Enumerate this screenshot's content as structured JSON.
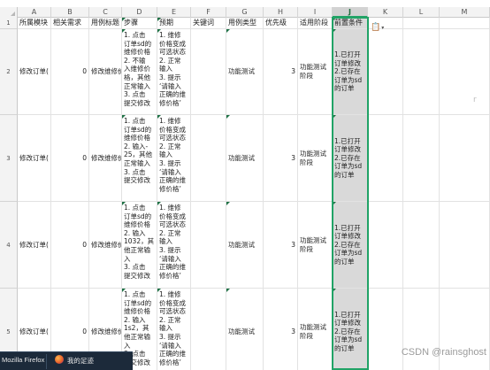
{
  "columns": [
    {
      "letter": "A"
    },
    {
      "letter": "B"
    },
    {
      "letter": "C"
    },
    {
      "letter": "D"
    },
    {
      "letter": "E"
    },
    {
      "letter": "F"
    },
    {
      "letter": "G"
    },
    {
      "letter": "H"
    },
    {
      "letter": "I"
    },
    {
      "letter": "J"
    },
    {
      "letter": "K"
    },
    {
      "letter": "L"
    },
    {
      "letter": "M"
    }
  ],
  "selected_column": "J",
  "rows": [
    {
      "number": "1"
    },
    {
      "number": "2"
    },
    {
      "number": "3"
    },
    {
      "number": "4"
    },
    {
      "number": "5"
    }
  ],
  "header_cells": [
    "所属模块",
    "相关需求",
    "用例标题",
    "步骤",
    "预期",
    "关键词",
    "用例类型",
    "优先级",
    "适用阶段",
    "前置条件"
  ],
  "data_rows": [
    {
      "module": "修改订单(",
      "requirement": "0",
      "title": "修改维修价",
      "steps": "1. 点击\n订单sd的\n维修价格\n2. 不输\n入维修价\n格，其他\n正常输入\n3. 点击\n提交修改",
      "expected": "1. 维修\n价格变成\n可选状态\n2. 正常\n输入\n3. 提示\n‘请输入\n正确的维\n修价格’",
      "keywords": "",
      "type": "功能测试",
      "priority": "3",
      "stage": "功能测试\n阶段",
      "precondition": "1.已打开\n订单修改\n2.已存在\n订单为sd\n的订单"
    },
    {
      "module": "修改订单(",
      "requirement": "0",
      "title": "修改维修价",
      "steps": "1. 点击\n订单sd的\n维修价格\n2. 输入-\n25，其他\n正常输入\n3. 点击\n提交修改",
      "expected": "1. 维修\n价格变成\n可选状态\n2. 正常\n输入\n3. 提示\n‘请输入\n正确的维\n修价格’",
      "keywords": "",
      "type": "功能测试",
      "priority": "3",
      "stage": "功能测试\n阶段",
      "precondition": "1.已打开\n订单修改\n2.已存在\n订单为sd\n的订单"
    },
    {
      "module": "修改订单(",
      "requirement": "0",
      "title": "修改维修价",
      "steps": "1. 点击\n订单sd的\n维修价格\n2. 输入\n1032，其\n他正常输\n入\n3. 点击\n提交修改",
      "expected": "1. 维修\n价格变成\n可选状态\n2. 正常\n输入\n3. 提示\n‘请输入\n正确的维\n修价格’",
      "keywords": "",
      "type": "功能测试",
      "priority": "3",
      "stage": "功能测试\n阶段",
      "precondition": "1.已打开\n订单修改\n2.已存在\n订单为sd\n的订单"
    },
    {
      "module": "修改订单(",
      "requirement": "0",
      "title": "修改维修价",
      "steps": "1. 点击\n订单sd的\n维修价格\n2. 输入\n1s2，其\n他正常输\n入\n3. 点击\n提交修改",
      "expected": "1. 维修\n价格变成\n可选状态\n2. 正常\n输入\n3. 提示\n‘请输入\n正确的维\n修价格’",
      "keywords": "",
      "type": "功能测试",
      "priority": "3",
      "stage": "功能测试\n阶段",
      "precondition": "1.已打开\n订单修改\n2.已存在\n订单为sd\n的订单"
    }
  ],
  "paste_options": {
    "icon": "paste-icon"
  },
  "taskbar": {
    "app_title": "Mozilla Firefox",
    "tab_title": "我的足迹",
    "app_icon": "firefox-icon"
  },
  "watermark": "CSDN @rainsghost",
  "float_mark": "r",
  "colors": {
    "selection": "#21a366",
    "flag": "#1e7145",
    "header_bg": "#f3f3f3"
  }
}
